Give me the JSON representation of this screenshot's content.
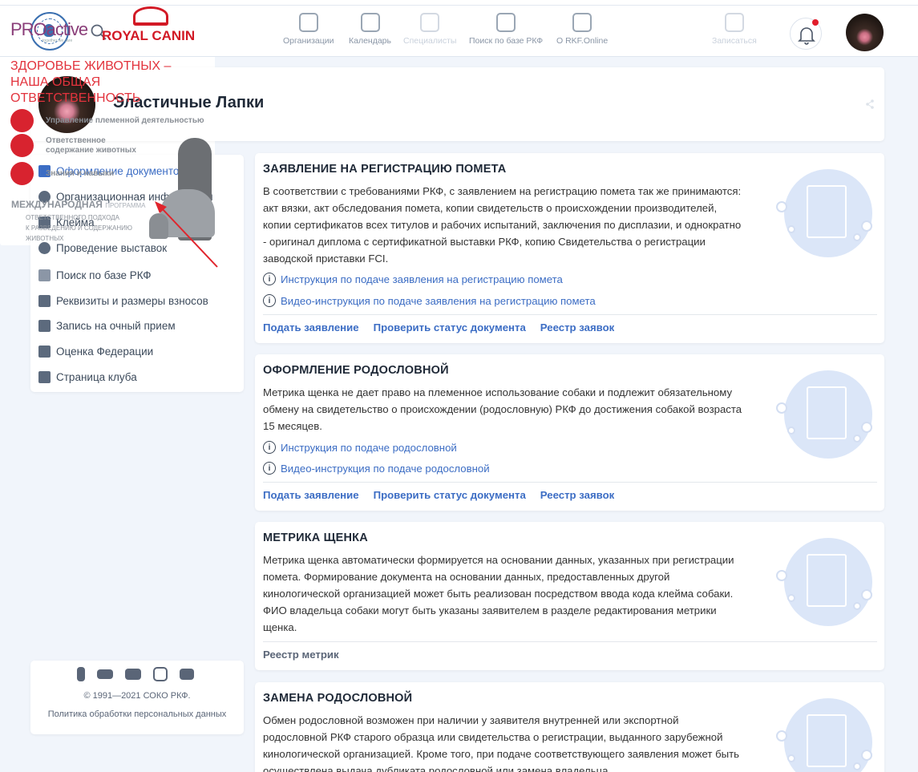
{
  "nav": {
    "items": [
      {
        "label": "Организации",
        "icon": "organizations-icon"
      },
      {
        "label": "Календарь",
        "icon": "calendar-icon"
      },
      {
        "label": "Специалисты",
        "icon": "specialists-icon"
      },
      {
        "label": "Поиск по базе РКФ",
        "icon": "search-database-icon"
      },
      {
        "label": "О RKF.Online",
        "icon": "chip-icon"
      }
    ],
    "signup": "Записаться"
  },
  "profile": {
    "name": "Эластичные Лапки"
  },
  "sidebar": {
    "items": [
      {
        "label": "Оформление документов",
        "icon": "document-icon"
      },
      {
        "label": "Организационная информация",
        "icon": "info-icon"
      },
      {
        "label": "Клейма",
        "icon": "barcode-icon"
      },
      {
        "label": "Проведение выставок",
        "icon": "medal-icon"
      },
      {
        "label": "Поиск по базе РКФ",
        "icon": "search-database-icon"
      },
      {
        "label": "Реквизиты и размеры взносов",
        "icon": "money-icon"
      },
      {
        "label": "Запись на очный прием",
        "icon": "clipboard-icon"
      },
      {
        "label": "Оценка Федерации",
        "icon": "rating-icon"
      },
      {
        "label": "Страница клуба",
        "icon": "page-icon"
      }
    ]
  },
  "promo": {
    "proactive": "PROactive",
    "proactive_tag": "together we care",
    "royal_canin": "ROYAL CANIN",
    "headline": "ЗДОРОВЬЕ ЖИВОТНЫХ – НАША ОБЩАЯ ОТВЕТСТВЕННОСТЬ",
    "items": [
      "Управление племенной деятельностью",
      "Ответственное содержание животных",
      "Знания и навыки"
    ],
    "intl_bold": "МЕЖДУНАРОДНАЯ",
    "intl_small": "ПРОГРАММА",
    "intl_lines": [
      "ОТВЕТСТВЕННОГО ПОДХОДА",
      "К РАЗВЕДЕНИЮ И СОДЕРЖАНИЮ",
      "ЖИВОТНЫХ"
    ]
  },
  "footer": {
    "social": [
      "facebook-icon",
      "vk-icon",
      "youtube-icon",
      "instagram-icon",
      "telegram-icon"
    ],
    "copyright": "© 1991—2021 СОКО РКФ.",
    "policy": "Политика обработки персональных данных"
  },
  "sections": [
    {
      "title": "ЗАЯВЛЕНИЕ НА РЕГИСТРАЦИЮ ПОМЕТА",
      "desc": "В соответствии с требованиями РКФ, с заявлением на регистрацию помета так же принимаются: акт вязки, акт обследования помета, копии свидетельств о происхождении производителей, копии сертификатов всех титулов и рабочих испытаний, заключения по дисплазии, и однократно - оригинал диплома с сертификатной выставки РКФ, копию Свидетельства о регистрации заводской приставки FCI.",
      "links": [
        "Инструкция по подаче заявления на регистрацию помета",
        "Видео-инструкция по подаче заявления на регистрацию помета"
      ],
      "actions": [
        "Подать заявление",
        "Проверить статус документа",
        "Реестр заявок"
      ]
    },
    {
      "title": "ОФОРМЛЕНИЕ РОДОСЛОВНОЙ",
      "desc": "Метрика щенка не дает право на племенное использование собаки и подлежит обязательному обмену на свидетельство о происхождении (родословную) РКФ до достижения собакой возраста 15 месяцев.",
      "links": [
        "Инструкция по подаче родословной",
        "Видео-инструкция по подаче родословной"
      ],
      "actions": [
        "Подать заявление",
        "Проверить статус документа",
        "Реестр заявок"
      ]
    },
    {
      "title": "МЕТРИКА ЩЕНКА",
      "desc": "Метрика щенка автоматически формируется на основании данных, указанных при регистрации помета. Формирование документа на основании данных, предоставленных другой кинологической организацией может быть реализован посредством ввода кода клейма собаки. ФИО владельца собаки могут быть указаны заявителем в разделе редактирования метрики щенка.",
      "links": [],
      "actions": [
        "Реестр метрик"
      ]
    },
    {
      "title": "ЗАМЕНА РОДОСЛОВНОЙ",
      "desc": "Обмен родословной возможен при наличии у заявителя внутренней или экспортной родословной РКФ старого образца или свидетельства о регистрации, выданного зарубежной кинологической организацией. Кроме того, при подаче соответствующего заявления может быть осуществлена выдача дубликата родословной или замена владельца",
      "links": [],
      "actions": []
    }
  ]
}
